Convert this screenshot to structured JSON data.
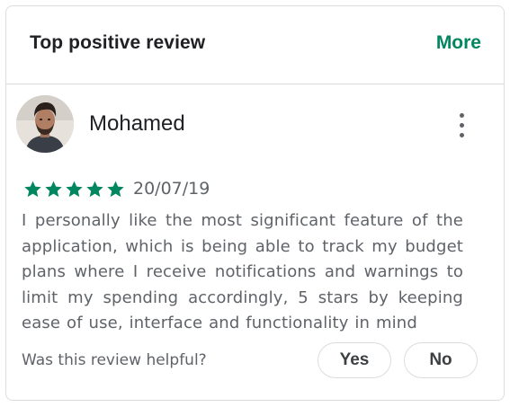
{
  "header": {
    "title": "Top positive review",
    "more_label": "More",
    "accent_color": "#01875f"
  },
  "review": {
    "reviewer_name": "Mohamed",
    "avatar_icon": "user-avatar-photo",
    "menu_icon": "more-vert-icon",
    "rating": 5,
    "rating_max": 5,
    "star_icon": "star-icon",
    "star_color": "#01875f",
    "date": "20/07/19",
    "text": "I personally like the most significant feature of the application, which is being able to track my budget plans where I receive notifications and warnings to limit my spending accordingly, 5 stars by keeping ease of use, interface and functionality in mind"
  },
  "helpful": {
    "question": "Was this review helpful?",
    "yes_label": "Yes",
    "no_label": "No"
  }
}
